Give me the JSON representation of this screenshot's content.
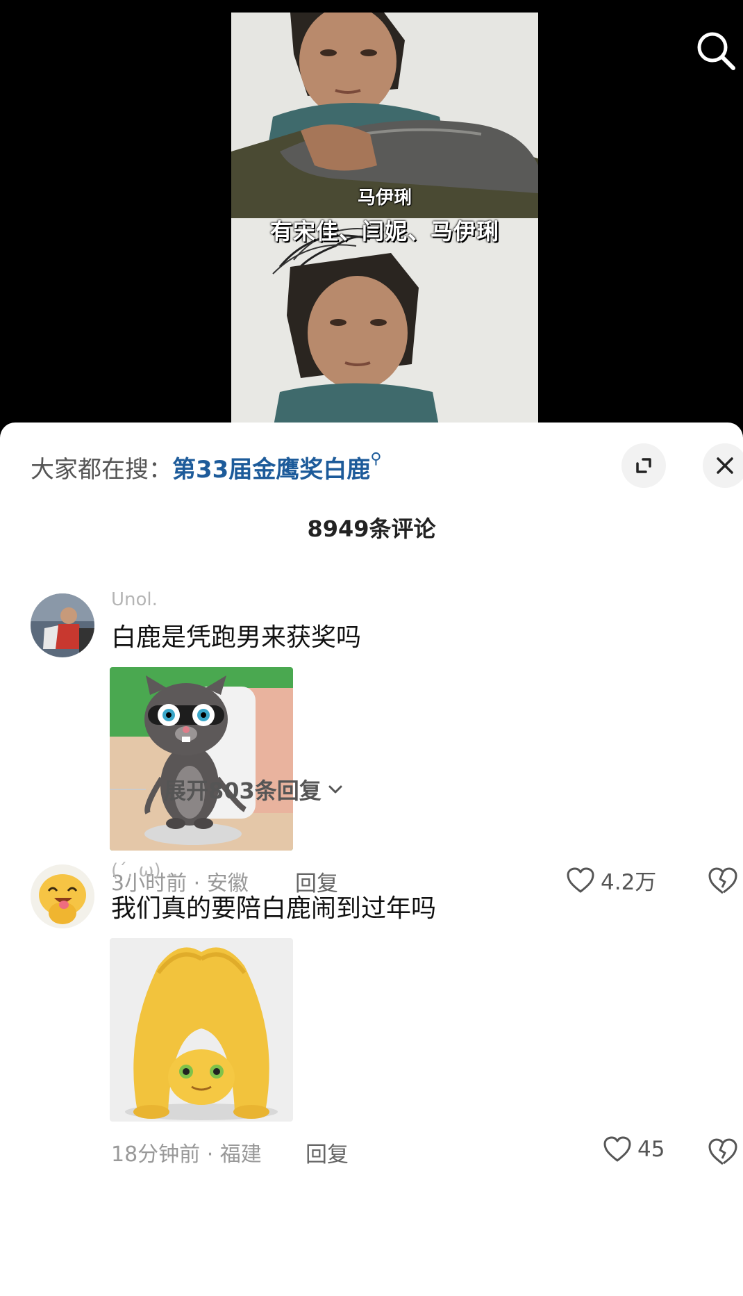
{
  "video": {
    "subtitle_small": "马伊琍",
    "subtitle_main": "有宋佳、闫妮、马伊琍"
  },
  "comments_panel": {
    "hot_search_label": "大家都在搜：",
    "hot_search_keyword": "第33届金鹰奖白鹿",
    "count_title": "8949条评论"
  },
  "comments": [
    {
      "username": "Unol.",
      "text": "白鹿是凭跑男来获奖吗",
      "meta": "3小时前 · 安徽",
      "reply_label": "回复",
      "likes": "4.2万",
      "expand_label": "展开803条回复"
    },
    {
      "username": "(´, ω) ..",
      "text": "我们真的要陪白鹿闹到过年吗",
      "meta": "18分钟前 · 福建",
      "reply_label": "回复",
      "likes": "45"
    }
  ],
  "colors": {
    "keyword": "#1d5b9a",
    "meta": "#999999",
    "text": "#111111"
  },
  "icons": [
    "search-icon",
    "expand-icon",
    "close-icon",
    "heart-icon",
    "broken-heart-icon",
    "chevron-down-icon"
  ]
}
